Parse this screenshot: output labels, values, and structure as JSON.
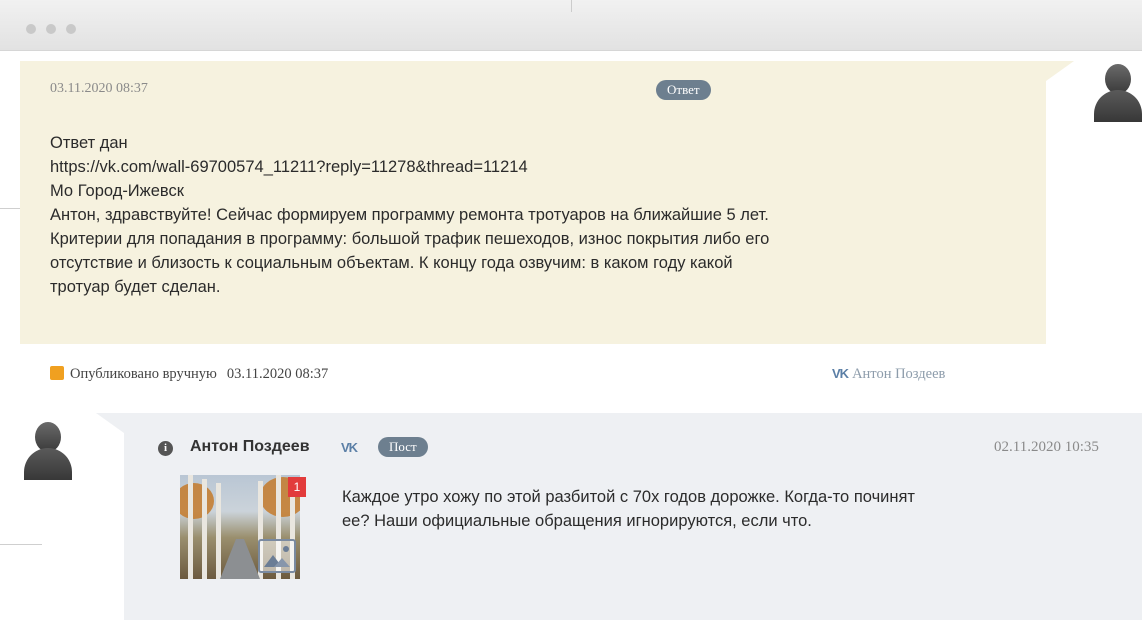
{
  "reply": {
    "date": "03.11.2020 08:37",
    "badge": "Ответ",
    "lines": [
      "Ответ дан",
      "https://vk.com/wall-69700574_11211?reply=11278&thread=11214",
      "Мо Город-Ижевск",
      "Антон, здравствуйте! Сейчас формируем программу ремонта тротуаров на ближайшие 5 лет.",
      "Критерии для попадания в программу: большой трафик пешеходов, износ покрытия либо его",
      "отсутствие и близость к социальным объектам. К концу года озвучим: в каком году какой",
      "тротуар будет сделан."
    ]
  },
  "meta": {
    "status": "Опубликовано вручную",
    "datetime": "03.11.2020 08:37",
    "vk_icon_text": "VK",
    "author": "Антон Поздеев"
  },
  "post": {
    "info_icon_text": "i",
    "author": "Антон Поздеев",
    "vk_icon_text": "VK",
    "badge": "Пост",
    "date": "02.11.2020 10:35",
    "image_count": "1",
    "lines": [
      "Каждое утро хожу по этой разбитой с 70х годов дорожке. Когда-то починят",
      "ее? Наши официальные обращения игнорируются, если что."
    ]
  },
  "colors": {
    "reply_bg": "#f6f2df",
    "post_bg": "#eef0f3",
    "badge": "#6d7f8f",
    "status_marker": "#f0a020",
    "image_badge": "#e23b3b"
  }
}
